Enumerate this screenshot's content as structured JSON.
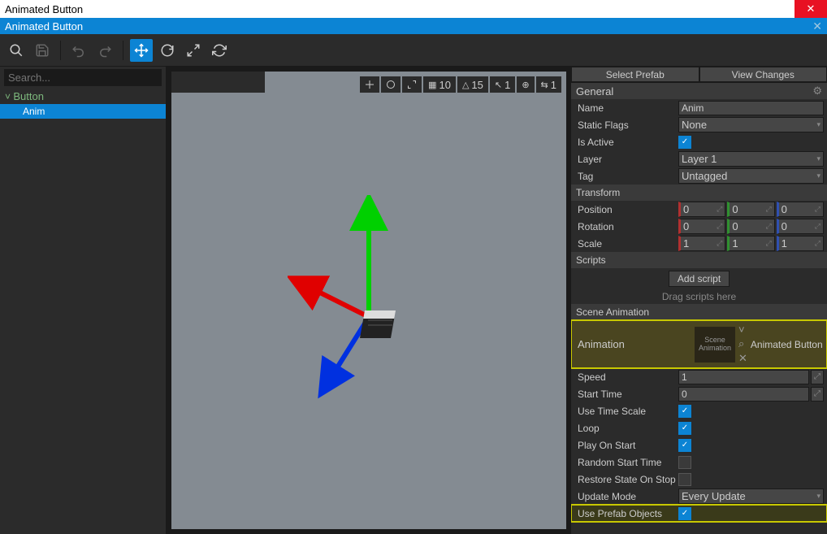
{
  "window": {
    "title": "Animated Button",
    "subtitle": "Animated Button"
  },
  "search": {
    "placeholder": "Search..."
  },
  "tree": {
    "root": "Button",
    "child": "Anim"
  },
  "viewport": {
    "grid_count": "10",
    "tri_count": "15",
    "snap_move": "1",
    "snap_rot": "1"
  },
  "buttons": {
    "select_prefab": "Select Prefab",
    "view_changes": "View Changes",
    "add_script": "Add script"
  },
  "sections": {
    "general": "General",
    "transform": "Transform",
    "scripts": "Scripts",
    "scene_anim": "Scene Animation"
  },
  "hints": {
    "drag_scripts": "Drag scripts here"
  },
  "general": {
    "name_label": "Name",
    "name_value": "Anim",
    "static_flags_label": "Static Flags",
    "static_flags_value": "None",
    "is_active_label": "Is Active",
    "layer_label": "Layer",
    "layer_value": "Layer 1",
    "tag_label": "Tag",
    "tag_value": "Untagged"
  },
  "transform": {
    "position_label": "Position",
    "position": {
      "x": "0",
      "y": "0",
      "z": "0"
    },
    "rotation_label": "Rotation",
    "rotation": {
      "x": "0",
      "y": "0",
      "z": "0"
    },
    "scale_label": "Scale",
    "scale": {
      "x": "1",
      "y": "1",
      "z": "1"
    }
  },
  "scene_anim": {
    "animation_label": "Animation",
    "thumb_text": "Scene Animation",
    "animation_value": "Animated Button",
    "speed_label": "Speed",
    "speed_value": "1",
    "start_time_label": "Start Time",
    "start_time_value": "0",
    "use_time_scale_label": "Use Time Scale",
    "loop_label": "Loop",
    "play_on_start_label": "Play On Start",
    "random_start_label": "Random Start Time",
    "restore_state_label": "Restore State On Stop",
    "update_mode_label": "Update Mode",
    "update_mode_value": "Every Update",
    "use_prefab_label": "Use Prefab Objects"
  }
}
